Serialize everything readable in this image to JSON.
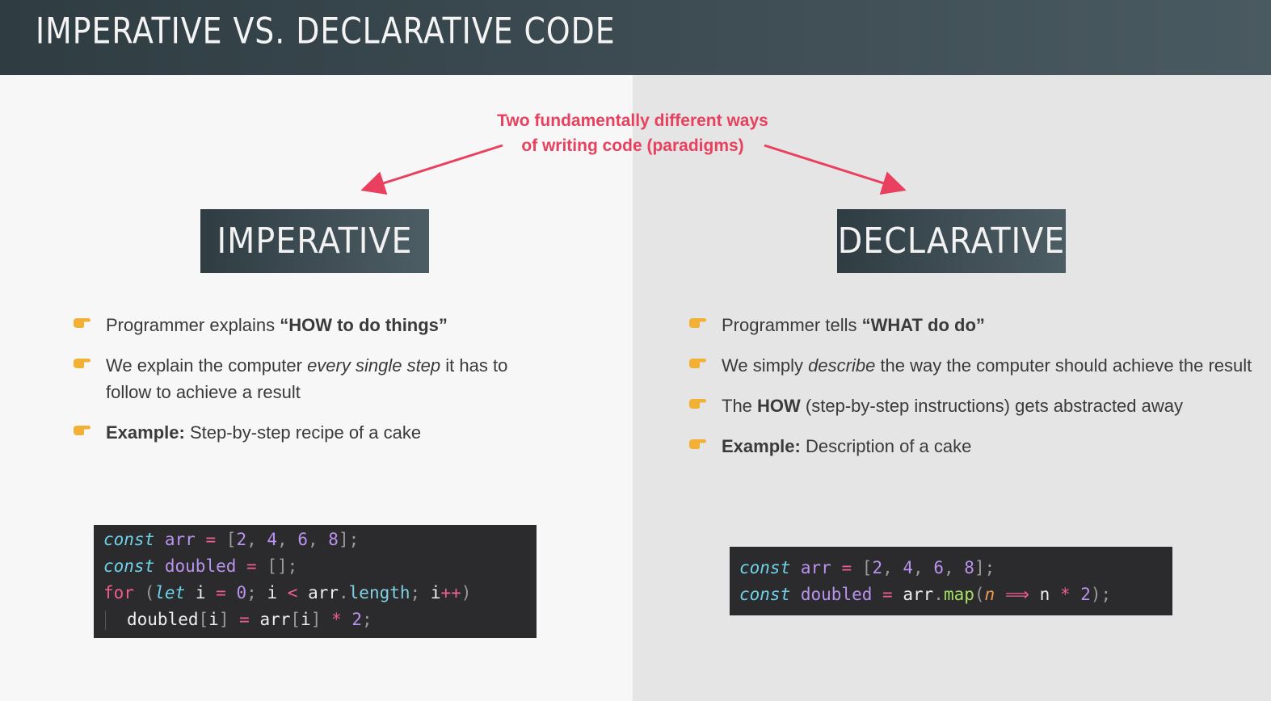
{
  "header": {
    "title": "IMPERATIVE VS. DECLARATIVE CODE"
  },
  "callout": {
    "line1": "Two fundamentally different ways",
    "line2": "of writing code (paradigms)"
  },
  "imperative": {
    "title": "IMPERATIVE",
    "bullets": [
      {
        "plain1": "Programmer explains ",
        "bold": "“HOW to do things”"
      },
      {
        "plain1": "We explain the computer ",
        "italic": "every single step",
        "plain2": " it has to follow to achieve a result"
      },
      {
        "bold": "Example:",
        "plain2": " Step-by-step recipe of a cake"
      }
    ],
    "code": {
      "kw_const": "const",
      "kw_let": "let",
      "kw_for": "for",
      "arr": "arr",
      "doubled": "doubled",
      "i": "i",
      "length": "length",
      "n2": "2",
      "n4": "4",
      "n6": "6",
      "n8": "8",
      "n0": "0"
    }
  },
  "declarative": {
    "title": "DECLARATIVE",
    "bullets": [
      {
        "plain1": "Programmer tells ",
        "bold": "“WHAT do do”"
      },
      {
        "plain1": "We simply ",
        "italic": "describe",
        "plain2": " the way the computer should achieve the result"
      },
      {
        "plain1": "The ",
        "bold": "HOW",
        "plain2": " (step-by-step instructions) gets abstracted away"
      },
      {
        "bold": "Example:",
        "plain2": " Description of a cake"
      }
    ],
    "code": {
      "map": "map",
      "param": "n"
    }
  },
  "colors": {
    "accent": "#e8405e",
    "header": "#2f3d43",
    "code_bg": "#2b2a2d",
    "bullet": "#f2b134"
  },
  "icons": {
    "bullet": "pointing-hand-icon"
  }
}
